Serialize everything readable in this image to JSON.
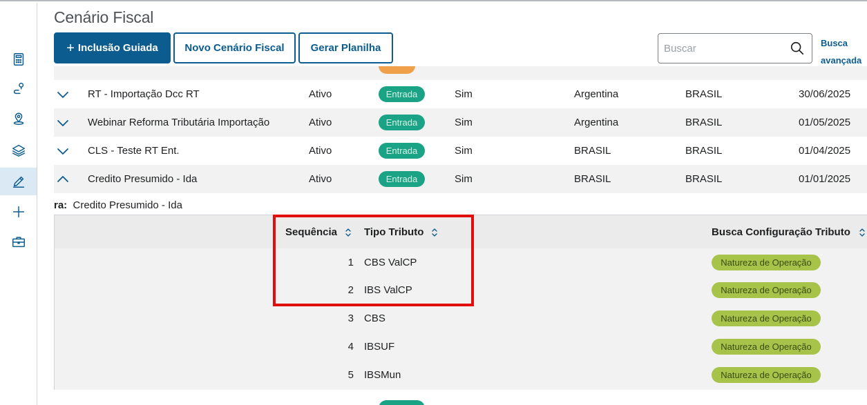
{
  "page": {
    "title": "Cenário Fiscal"
  },
  "toolbar": {
    "inclusao_label": "Inclusão Guiada",
    "novo_label": "Novo Cenário Fiscal",
    "gerar_label": "Gerar Planilha"
  },
  "search": {
    "placeholder": "Buscar",
    "advanced_label_line1": "Busca",
    "advanced_label_line2": "avançada"
  },
  "sidebar": {
    "items": [
      {
        "icon": "calculator-icon"
      },
      {
        "icon": "route-pin-icon"
      },
      {
        "icon": "location-pin-icon"
      },
      {
        "icon": "layers-icon"
      },
      {
        "icon": "pencil-icon",
        "active": true
      },
      {
        "icon": "plus-icon"
      },
      {
        "icon": "briefcase-icon"
      }
    ]
  },
  "rows": [
    {
      "name": "RT - Importação Dcc RT",
      "status": "Ativo",
      "tipo": "Entrada",
      "flag": "Sim",
      "origem": "Argentina",
      "destino": "BRASIL",
      "data": "30/06/2025",
      "expanded": false
    },
    {
      "name": "Webinar Reforma Tributária Importação",
      "status": "Ativo",
      "tipo": "Entrada",
      "flag": "Sim",
      "origem": "Argentina",
      "destino": "BRASIL",
      "data": "01/05/2025",
      "expanded": false
    },
    {
      "name": "CLS - Teste RT Ent.",
      "status": "Ativo",
      "tipo": "Entrada",
      "flag": "Sim",
      "origem": "BRASIL",
      "destino": "BRASIL",
      "data": "01/04/2025",
      "expanded": false
    },
    {
      "name": "Credito Presumido - Ida",
      "status": "Ativo",
      "tipo": "Entrada",
      "flag": "Sim",
      "origem": "BRASIL",
      "destino": "BRASIL",
      "data": "01/01/2025",
      "expanded": true
    }
  ],
  "detail": {
    "label_prefix": "ra:",
    "label_value": "Credito Presumido - Ida",
    "columns": {
      "sequencia": "Sequência",
      "tipo_tributo": "Tipo Tributo",
      "busca_config": "Busca Configuração Tributo"
    },
    "items": [
      {
        "seq": "1",
        "tipo": "CBS ValCP",
        "busca": "Natureza de Operação"
      },
      {
        "seq": "2",
        "tipo": "IBS ValCP",
        "busca": "Natureza de Operação"
      },
      {
        "seq": "3",
        "tipo": "CBS",
        "busca": "Natureza de Operação"
      },
      {
        "seq": "4",
        "tipo": "IBSUF",
        "busca": "Natureza de Operação"
      },
      {
        "seq": "5",
        "tipo": "IBSMun",
        "busca": "Natureza de Operação"
      }
    ]
  },
  "colors": {
    "primary": "#0c5c8f",
    "entrada": "#1aa384",
    "natureza": "#a7c34a",
    "highlight": "#e10e0e",
    "partial_badge": "#f0a04b"
  }
}
